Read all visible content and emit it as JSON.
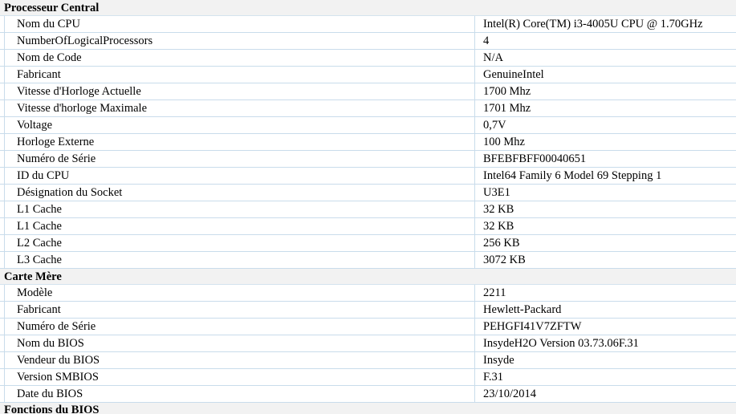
{
  "sections": [
    {
      "title": "Processeur Central",
      "rows": [
        {
          "label": "Nom du CPU",
          "value": "Intel(R) Core(TM) i3-4005U CPU @ 1.70GHz"
        },
        {
          "label": "NumberOfLogicalProcessors",
          "value": "4"
        },
        {
          "label": "Nom de Code",
          "value": "N/A"
        },
        {
          "label": "Fabricant",
          "value": "GenuineIntel"
        },
        {
          "label": "Vitesse d'Horloge Actuelle",
          "value": "1700 Mhz"
        },
        {
          "label": "Vitesse d'horloge Maximale",
          "value": "1701 Mhz"
        },
        {
          "label": "Voltage",
          "value": "0,7V"
        },
        {
          "label": "Horloge Externe",
          "value": "100 Mhz"
        },
        {
          "label": "Numéro de Série",
          "value": "BFEBFBFF00040651"
        },
        {
          "label": "ID du CPU",
          "value": "Intel64 Family 6 Model 69 Stepping 1"
        },
        {
          "label": "Désignation du Socket",
          "value": "U3E1"
        },
        {
          "label": "L1 Cache",
          "value": "32 KB"
        },
        {
          "label": "L1 Cache",
          "value": "32 KB"
        },
        {
          "label": "L2 Cache",
          "value": "256 KB"
        },
        {
          "label": "L3 Cache",
          "value": "3072 KB"
        }
      ]
    },
    {
      "title": "Carte Mère",
      "rows": [
        {
          "label": "Modèle",
          "value": "2211"
        },
        {
          "label": "Fabricant",
          "value": "Hewlett-Packard"
        },
        {
          "label": "Numéro de Série",
          "value": "PEHGFI41V7ZFTW"
        },
        {
          "label": "Nom du BIOS",
          "value": "InsydeH2O Version 03.73.06F.31"
        },
        {
          "label": "Vendeur du BIOS",
          "value": "Insyde"
        },
        {
          "label": "Version SMBIOS",
          "value": "F.31"
        },
        {
          "label": "Date du BIOS",
          "value": "23/10/2014"
        }
      ]
    },
    {
      "title": "Fonctions du BIOS",
      "rows": []
    }
  ]
}
